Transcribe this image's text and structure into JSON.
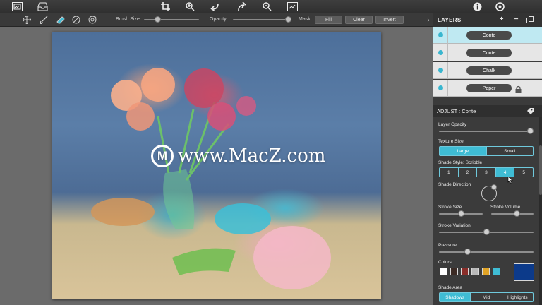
{
  "toolbar": {
    "icons": [
      "layers-view-icon",
      "inbox-tray-icon",
      "crop-icon",
      "zoom-in-icon",
      "undo-icon",
      "redo-icon",
      "zoom-out-icon",
      "fit-screen-icon",
      "info-icon",
      "settings-icon"
    ]
  },
  "options": {
    "brush_size_label": "Brush Size:",
    "opacity_label": "Opacity:",
    "mask_label": "Mask:",
    "fill_label": "Fill",
    "clear_label": "Clear",
    "invert_label": "Invert",
    "brush_size_value": 0.25,
    "opacity_value": 0.98,
    "tools": [
      "move-tool-icon",
      "brush-tool-icon",
      "eraser-tool-icon",
      "pick-tool-icon",
      "target-tool-icon"
    ]
  },
  "watermark": {
    "logo_letter": "M",
    "text": "www.MacZ.com"
  },
  "layers": {
    "title": "LAYERS",
    "add_label": "+",
    "remove_label": "−",
    "items": [
      {
        "name": "Conte",
        "selected": true
      },
      {
        "name": "Conte",
        "selected": false
      },
      {
        "name": "Chalk",
        "selected": false
      },
      {
        "name": "Paper",
        "selected": false,
        "locked": true
      }
    ]
  },
  "adjust": {
    "title": "ADJUST : Conte",
    "layer_opacity_label": "Layer Opacity",
    "layer_opacity_value": 0.97,
    "texture_size_label": "Texture Size",
    "texture_options": [
      "Large",
      "Small"
    ],
    "texture_selected": 0,
    "shade_style_label": "Shade Style: Scribble",
    "shade_style_options": [
      "1",
      "2",
      "3",
      "4",
      "5"
    ],
    "shade_style_selected": 3,
    "shade_direction_label": "Shade Direction",
    "stroke_size_label": "Stroke Size",
    "stroke_size_value": 0.5,
    "stroke_volume_label": "Stroke Volume",
    "stroke_volume_value": 0.6,
    "stroke_variation_label": "Stroke Variation",
    "stroke_variation_value": 0.5,
    "pressure_label": "Pressure",
    "pressure_value": 0.3,
    "colors_label": "Colors",
    "swatches": [
      "#ffffff",
      "#3b2a24",
      "#8a2e2a",
      "#b9b9b9",
      "#e0a326",
      "#3fbcd4"
    ],
    "current_color": "#0c3a8a",
    "shade_area_label": "Shade Area",
    "shade_area_options": [
      "Shadows",
      "Mid",
      "Highlights"
    ],
    "shade_area_selected": 0
  },
  "colors": {
    "accent": "#3fbcd4",
    "panel_bg": "#3b3b3b",
    "toolbar_bg": "#333333"
  }
}
